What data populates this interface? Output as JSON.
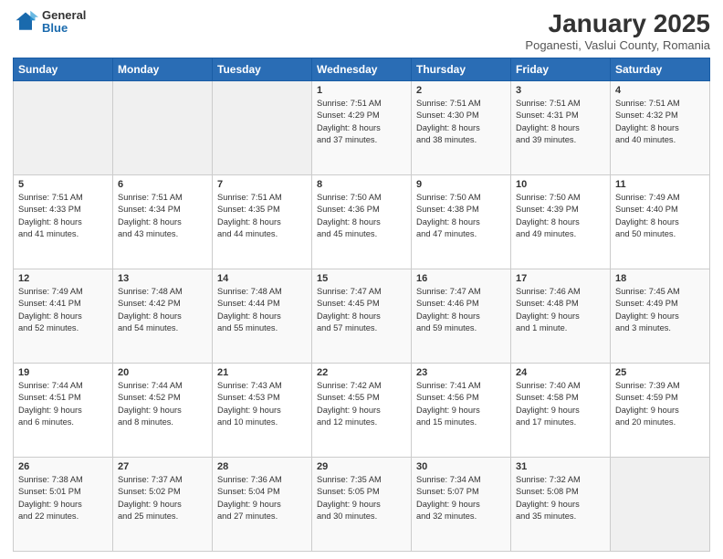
{
  "header": {
    "logo_general": "General",
    "logo_blue": "Blue",
    "month": "January 2025",
    "location": "Poganesti, Vaslui County, Romania"
  },
  "days_of_week": [
    "Sunday",
    "Monday",
    "Tuesday",
    "Wednesday",
    "Thursday",
    "Friday",
    "Saturday"
  ],
  "weeks": [
    [
      {
        "day": "",
        "text": ""
      },
      {
        "day": "",
        "text": ""
      },
      {
        "day": "",
        "text": ""
      },
      {
        "day": "1",
        "text": "Sunrise: 7:51 AM\nSunset: 4:29 PM\nDaylight: 8 hours\nand 37 minutes."
      },
      {
        "day": "2",
        "text": "Sunrise: 7:51 AM\nSunset: 4:30 PM\nDaylight: 8 hours\nand 38 minutes."
      },
      {
        "day": "3",
        "text": "Sunrise: 7:51 AM\nSunset: 4:31 PM\nDaylight: 8 hours\nand 39 minutes."
      },
      {
        "day": "4",
        "text": "Sunrise: 7:51 AM\nSunset: 4:32 PM\nDaylight: 8 hours\nand 40 minutes."
      }
    ],
    [
      {
        "day": "5",
        "text": "Sunrise: 7:51 AM\nSunset: 4:33 PM\nDaylight: 8 hours\nand 41 minutes."
      },
      {
        "day": "6",
        "text": "Sunrise: 7:51 AM\nSunset: 4:34 PM\nDaylight: 8 hours\nand 43 minutes."
      },
      {
        "day": "7",
        "text": "Sunrise: 7:51 AM\nSunset: 4:35 PM\nDaylight: 8 hours\nand 44 minutes."
      },
      {
        "day": "8",
        "text": "Sunrise: 7:50 AM\nSunset: 4:36 PM\nDaylight: 8 hours\nand 45 minutes."
      },
      {
        "day": "9",
        "text": "Sunrise: 7:50 AM\nSunset: 4:38 PM\nDaylight: 8 hours\nand 47 minutes."
      },
      {
        "day": "10",
        "text": "Sunrise: 7:50 AM\nSunset: 4:39 PM\nDaylight: 8 hours\nand 49 minutes."
      },
      {
        "day": "11",
        "text": "Sunrise: 7:49 AM\nSunset: 4:40 PM\nDaylight: 8 hours\nand 50 minutes."
      }
    ],
    [
      {
        "day": "12",
        "text": "Sunrise: 7:49 AM\nSunset: 4:41 PM\nDaylight: 8 hours\nand 52 minutes."
      },
      {
        "day": "13",
        "text": "Sunrise: 7:48 AM\nSunset: 4:42 PM\nDaylight: 8 hours\nand 54 minutes."
      },
      {
        "day": "14",
        "text": "Sunrise: 7:48 AM\nSunset: 4:44 PM\nDaylight: 8 hours\nand 55 minutes."
      },
      {
        "day": "15",
        "text": "Sunrise: 7:47 AM\nSunset: 4:45 PM\nDaylight: 8 hours\nand 57 minutes."
      },
      {
        "day": "16",
        "text": "Sunrise: 7:47 AM\nSunset: 4:46 PM\nDaylight: 8 hours\nand 59 minutes."
      },
      {
        "day": "17",
        "text": "Sunrise: 7:46 AM\nSunset: 4:48 PM\nDaylight: 9 hours\nand 1 minute."
      },
      {
        "day": "18",
        "text": "Sunrise: 7:45 AM\nSunset: 4:49 PM\nDaylight: 9 hours\nand 3 minutes."
      }
    ],
    [
      {
        "day": "19",
        "text": "Sunrise: 7:44 AM\nSunset: 4:51 PM\nDaylight: 9 hours\nand 6 minutes."
      },
      {
        "day": "20",
        "text": "Sunrise: 7:44 AM\nSunset: 4:52 PM\nDaylight: 9 hours\nand 8 minutes."
      },
      {
        "day": "21",
        "text": "Sunrise: 7:43 AM\nSunset: 4:53 PM\nDaylight: 9 hours\nand 10 minutes."
      },
      {
        "day": "22",
        "text": "Sunrise: 7:42 AM\nSunset: 4:55 PM\nDaylight: 9 hours\nand 12 minutes."
      },
      {
        "day": "23",
        "text": "Sunrise: 7:41 AM\nSunset: 4:56 PM\nDaylight: 9 hours\nand 15 minutes."
      },
      {
        "day": "24",
        "text": "Sunrise: 7:40 AM\nSunset: 4:58 PM\nDaylight: 9 hours\nand 17 minutes."
      },
      {
        "day": "25",
        "text": "Sunrise: 7:39 AM\nSunset: 4:59 PM\nDaylight: 9 hours\nand 20 minutes."
      }
    ],
    [
      {
        "day": "26",
        "text": "Sunrise: 7:38 AM\nSunset: 5:01 PM\nDaylight: 9 hours\nand 22 minutes."
      },
      {
        "day": "27",
        "text": "Sunrise: 7:37 AM\nSunset: 5:02 PM\nDaylight: 9 hours\nand 25 minutes."
      },
      {
        "day": "28",
        "text": "Sunrise: 7:36 AM\nSunset: 5:04 PM\nDaylight: 9 hours\nand 27 minutes."
      },
      {
        "day": "29",
        "text": "Sunrise: 7:35 AM\nSunset: 5:05 PM\nDaylight: 9 hours\nand 30 minutes."
      },
      {
        "day": "30",
        "text": "Sunrise: 7:34 AM\nSunset: 5:07 PM\nDaylight: 9 hours\nand 32 minutes."
      },
      {
        "day": "31",
        "text": "Sunrise: 7:32 AM\nSunset: 5:08 PM\nDaylight: 9 hours\nand 35 minutes."
      },
      {
        "day": "",
        "text": ""
      }
    ]
  ]
}
